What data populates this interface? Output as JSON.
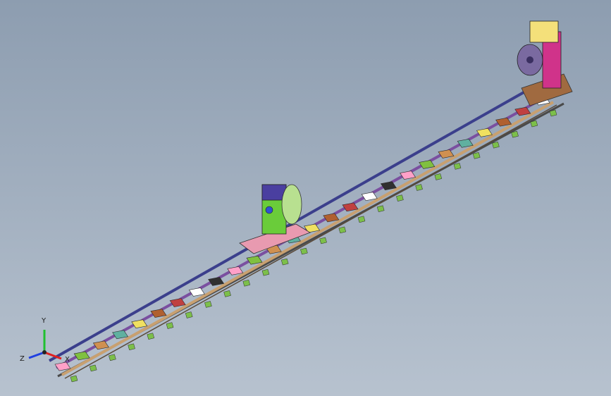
{
  "viewport": {
    "background_top": "#8d9db0",
    "background_bottom": "#b7c2cf"
  },
  "triad": {
    "x_label": "X",
    "y_label": "Y",
    "z_label": "Z",
    "x_color": "#e02020",
    "y_color": "#20c030",
    "z_color": "#2040e0"
  },
  "model": {
    "rail_colors": [
      "#7a4fa0",
      "#c8a070",
      "#3b3f8c"
    ],
    "tailstock_positioner_color": "#6acc3a",
    "headstock_positioner_color": "#d0338a",
    "headstock_top_color": "#f4e07a",
    "sleeper_colors": [
      "#ffa0c8",
      "#80c040",
      "#d09050",
      "#60b0a0",
      "#f0e060",
      "#b06030",
      "#c04040",
      "#ffffff",
      "#303030"
    ]
  }
}
